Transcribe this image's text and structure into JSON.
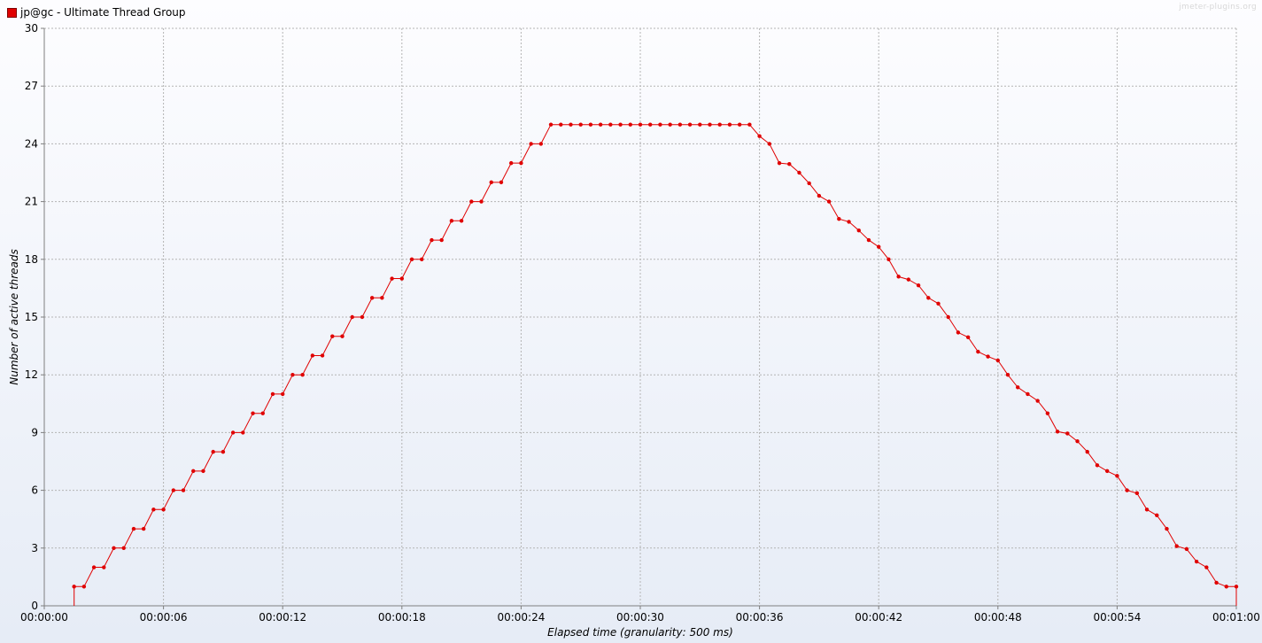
{
  "legend": {
    "series_name": "jp@gc - Ultimate Thread Group",
    "color": "#e00000"
  },
  "watermark": "jmeter-plugins.org",
  "chart_data": {
    "type": "line",
    "title": "",
    "xlabel": "Elapsed time (granularity: 500 ms)",
    "ylabel": "Number of active threads",
    "xlim": [
      0,
      60
    ],
    "ylim": [
      0,
      30
    ],
    "x_ticks": [
      "00:00:00",
      "00:00:06",
      "00:00:12",
      "00:00:18",
      "00:00:24",
      "00:00:30",
      "00:00:36",
      "00:00:42",
      "00:00:48",
      "00:00:54",
      "00:01:00"
    ],
    "y_ticks": [
      "0",
      "3",
      "6",
      "9",
      "12",
      "15",
      "18",
      "21",
      "24",
      "27",
      "30"
    ],
    "grid": true,
    "background_gradient": [
      "#fdfdff",
      "#e6ecf6"
    ],
    "series": [
      {
        "name": "jp@gc - Ultimate Thread Group",
        "color": "#e00000",
        "points": [
          [
            1.5,
            0
          ],
          [
            1.5,
            1
          ],
          [
            2,
            1
          ],
          [
            2.5,
            2
          ],
          [
            3,
            2
          ],
          [
            3.5,
            3
          ],
          [
            4,
            3
          ],
          [
            4.5,
            4
          ],
          [
            5,
            4
          ],
          [
            5.5,
            5
          ],
          [
            6,
            5
          ],
          [
            6.5,
            6
          ],
          [
            7,
            6
          ],
          [
            7.5,
            7
          ],
          [
            8,
            7
          ],
          [
            8.5,
            8
          ],
          [
            9,
            8
          ],
          [
            9.5,
            9
          ],
          [
            10,
            9
          ],
          [
            10.5,
            10
          ],
          [
            11,
            10
          ],
          [
            11.5,
            11
          ],
          [
            12,
            11
          ],
          [
            12.5,
            12
          ],
          [
            13,
            12
          ],
          [
            13.5,
            13
          ],
          [
            14,
            13
          ],
          [
            14.5,
            14
          ],
          [
            15,
            14
          ],
          [
            15.5,
            15
          ],
          [
            16,
            15
          ],
          [
            16.5,
            16
          ],
          [
            17,
            16
          ],
          [
            17.5,
            17
          ],
          [
            18,
            17
          ],
          [
            18.5,
            18
          ],
          [
            19,
            18
          ],
          [
            19.5,
            19
          ],
          [
            20,
            19
          ],
          [
            20.5,
            20
          ],
          [
            21,
            20
          ],
          [
            21.5,
            21
          ],
          [
            22,
            21
          ],
          [
            22.5,
            22
          ],
          [
            23,
            22
          ],
          [
            23.5,
            23
          ],
          [
            24,
            23
          ],
          [
            24.5,
            24
          ],
          [
            25,
            24
          ],
          [
            25.5,
            25
          ],
          [
            26,
            25
          ],
          [
            26.5,
            25
          ],
          [
            27,
            25
          ],
          [
            27.5,
            25
          ],
          [
            28,
            25
          ],
          [
            28.5,
            25
          ],
          [
            29,
            25
          ],
          [
            29.5,
            25
          ],
          [
            30,
            25
          ],
          [
            30.5,
            25
          ],
          [
            31,
            25
          ],
          [
            31.5,
            25
          ],
          [
            32,
            25
          ],
          [
            32.5,
            25
          ],
          [
            33,
            25
          ],
          [
            33.5,
            25
          ],
          [
            34,
            25
          ],
          [
            34.5,
            25
          ],
          [
            35,
            25
          ],
          [
            35.5,
            25
          ],
          [
            36,
            24.4
          ],
          [
            36.5,
            24
          ],
          [
            37,
            23
          ],
          [
            37.5,
            22.95
          ],
          [
            38,
            22.5
          ],
          [
            38.5,
            21.95
          ],
          [
            39,
            21.3
          ],
          [
            39.5,
            21
          ],
          [
            40,
            20.1
          ],
          [
            40.5,
            19.95
          ],
          [
            41,
            19.5
          ],
          [
            41.5,
            19
          ],
          [
            42,
            18.65
          ],
          [
            42.5,
            18
          ],
          [
            43,
            17.1
          ],
          [
            43.5,
            16.95
          ],
          [
            44,
            16.65
          ],
          [
            44.5,
            16
          ],
          [
            45,
            15.7
          ],
          [
            45.5,
            15
          ],
          [
            46,
            14.2
          ],
          [
            46.5,
            13.95
          ],
          [
            47,
            13.2
          ],
          [
            47.5,
            12.95
          ],
          [
            48,
            12.75
          ],
          [
            48.5,
            12
          ],
          [
            49,
            11.35
          ],
          [
            49.5,
            11
          ],
          [
            50,
            10.65
          ],
          [
            50.5,
            10
          ],
          [
            51,
            9.05
          ],
          [
            51.5,
            8.95
          ],
          [
            52,
            8.55
          ],
          [
            52.5,
            8
          ],
          [
            53,
            7.3
          ],
          [
            53.5,
            7
          ],
          [
            54,
            6.75
          ],
          [
            54.5,
            6
          ],
          [
            55,
            5.85
          ],
          [
            55.5,
            5
          ],
          [
            56,
            4.7
          ],
          [
            56.5,
            4
          ],
          [
            57,
            3.1
          ],
          [
            57.5,
            2.95
          ],
          [
            58,
            2.3
          ],
          [
            58.5,
            2
          ],
          [
            59,
            1.2
          ],
          [
            59.5,
            1
          ],
          [
            60,
            1
          ],
          [
            60,
            0
          ]
        ]
      }
    ]
  }
}
